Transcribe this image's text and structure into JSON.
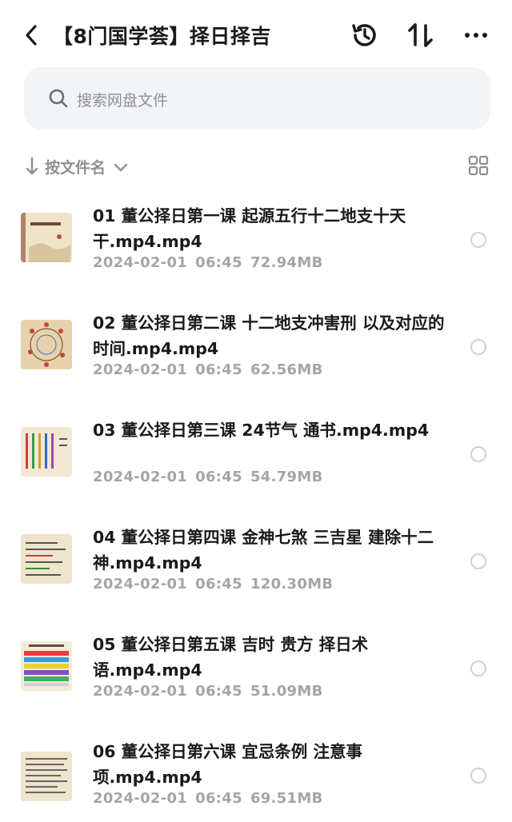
{
  "header": {
    "title": "【8门国学荟】择日择吉",
    "back_icon": "chevron-left-icon",
    "history_icon": "history-icon",
    "sort_icon": "sort-arrows-icon",
    "more_icon": "more-dots-icon"
  },
  "search": {
    "placeholder": "搜索网盘文件"
  },
  "sort": {
    "label": "按文件名"
  },
  "files": [
    {
      "name": "01 董公择日第一课 起源五行十二地支十天干.mp4.mp4",
      "date": "2024-02-01",
      "time": "06:45",
      "size": "72.94MB"
    },
    {
      "name": "02 董公择日第二课 十二地支冲害刑 以及对应的时间.mp4.mp4",
      "date": "2024-02-01",
      "time": "06:45",
      "size": "62.56MB"
    },
    {
      "name": "03 董公择日第三课 24节气 通书.mp4.mp4",
      "date": "2024-02-01",
      "time": "06:45",
      "size": "54.79MB"
    },
    {
      "name": "04 董公择日第四课  金神七煞 三吉星 建除十二神.mp4.mp4",
      "date": "2024-02-01",
      "time": "06:45",
      "size": "120.30MB"
    },
    {
      "name": "05 董公择日第五课  吉时 贵方 择日术语.mp4.mp4",
      "date": "2024-02-01",
      "time": "06:45",
      "size": "51.09MB"
    },
    {
      "name": "06 董公择日第六课 宜忌条例 注意事项.mp4.mp4",
      "date": "2024-02-01",
      "time": "06:45",
      "size": "69.51MB"
    }
  ]
}
